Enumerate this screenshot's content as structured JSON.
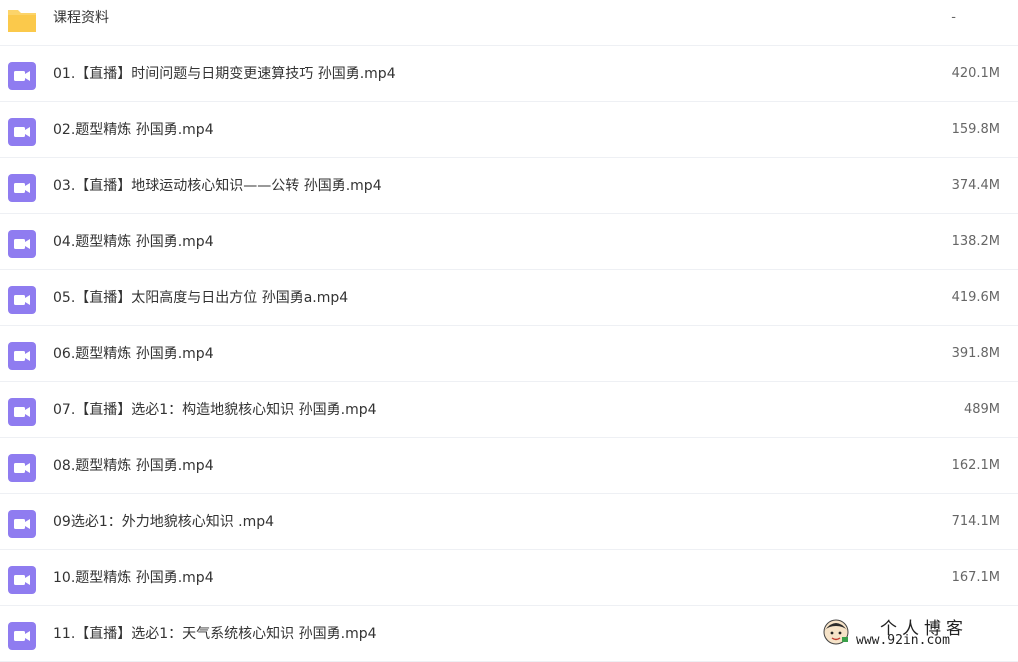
{
  "colors": {
    "folder_icon": "#fcd46a",
    "video_icon": "#8f7cf0",
    "row_divider": "#eef0f4",
    "text_primary": "#333333",
    "text_secondary": "#666666"
  },
  "files": [
    {
      "icon": "folder-icon",
      "name": "课程资料",
      "size": "-"
    },
    {
      "icon": "video-file-icon",
      "name": "01.【直播】时间问题与日期变更速算技巧 孙国勇.mp4",
      "size": "420.1M"
    },
    {
      "icon": "video-file-icon",
      "name": "02.题型精炼 孙国勇.mp4",
      "size": "159.8M"
    },
    {
      "icon": "video-file-icon",
      "name": "03.【直播】地球运动核心知识——公转 孙国勇.mp4",
      "size": "374.4M"
    },
    {
      "icon": "video-file-icon",
      "name": "04.题型精炼 孙国勇.mp4",
      "size": "138.2M"
    },
    {
      "icon": "video-file-icon",
      "name": "05.【直播】太阳高度与日出方位 孙国勇a.mp4",
      "size": "419.6M"
    },
    {
      "icon": "video-file-icon",
      "name": "06.题型精炼 孙国勇.mp4",
      "size": "391.8M"
    },
    {
      "icon": "video-file-icon",
      "name": "07.【直播】选必1：构造地貌核心知识 孙国勇.mp4",
      "size": "489M"
    },
    {
      "icon": "video-file-icon",
      "name": "08.题型精炼 孙国勇.mp4",
      "size": "162.1M"
    },
    {
      "icon": "video-file-icon",
      "name": "09选必1：外力地貌核心知识 .mp4",
      "size": "714.1M"
    },
    {
      "icon": "video-file-icon",
      "name": "10.题型精炼 孙国勇.mp4",
      "size": "167.1M"
    },
    {
      "icon": "video-file-icon",
      "name": "11.【直播】选必1：天气系统核心知识 孙国勇.mp4",
      "size": ""
    }
  ],
  "watermark": {
    "title": "个人博客",
    "url": "www.92in.com"
  }
}
